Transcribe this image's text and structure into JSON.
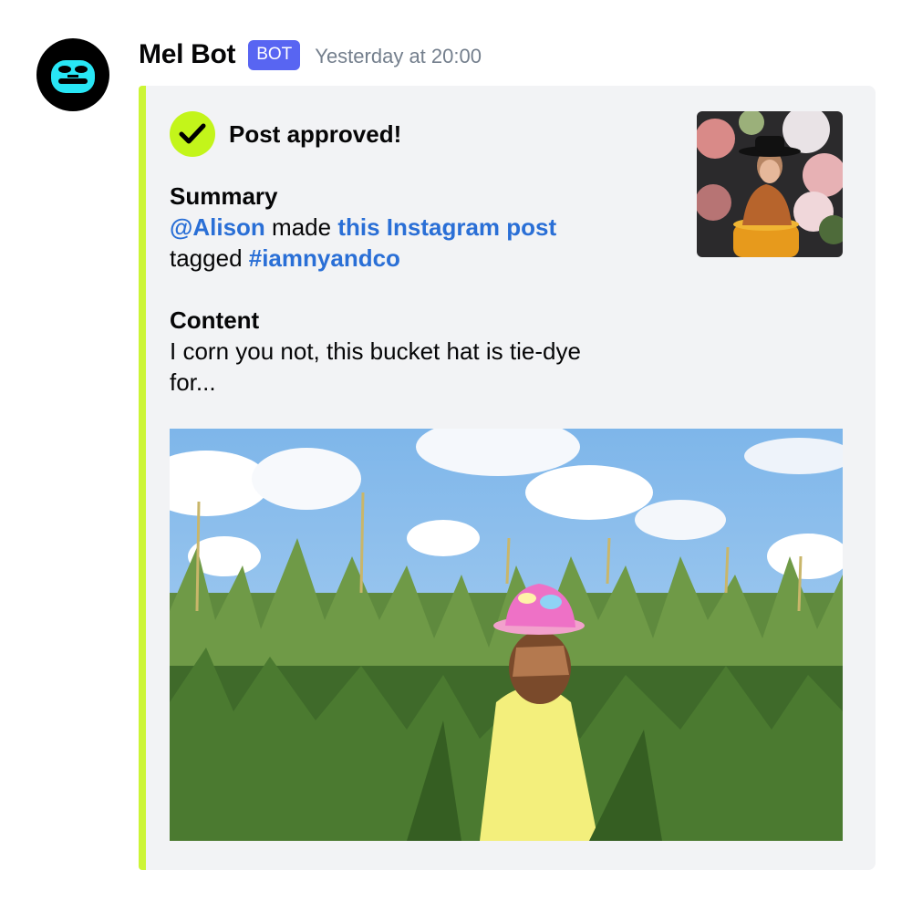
{
  "message": {
    "username": "Mel Bot",
    "badge": "BOT",
    "timestamp": "Yesterday at 20:00",
    "avatar_icon": "bot-face-icon"
  },
  "embed": {
    "accent_color": "#ccf536",
    "title_icon": "checkmark-icon",
    "title": "Post approved!",
    "summary": {
      "name": "Summary",
      "mention": "@Alison",
      "made": " made ",
      "post_link": "this Instagram post",
      "tagged": "tagged ",
      "hashtag": "#iamnyandco"
    },
    "content": {
      "name": "Content",
      "value": "I corn you not, this bucket hat is tie-dye for..."
    },
    "thumbnail_icon": "post-thumbnail-image",
    "image_icon": "post-image"
  }
}
